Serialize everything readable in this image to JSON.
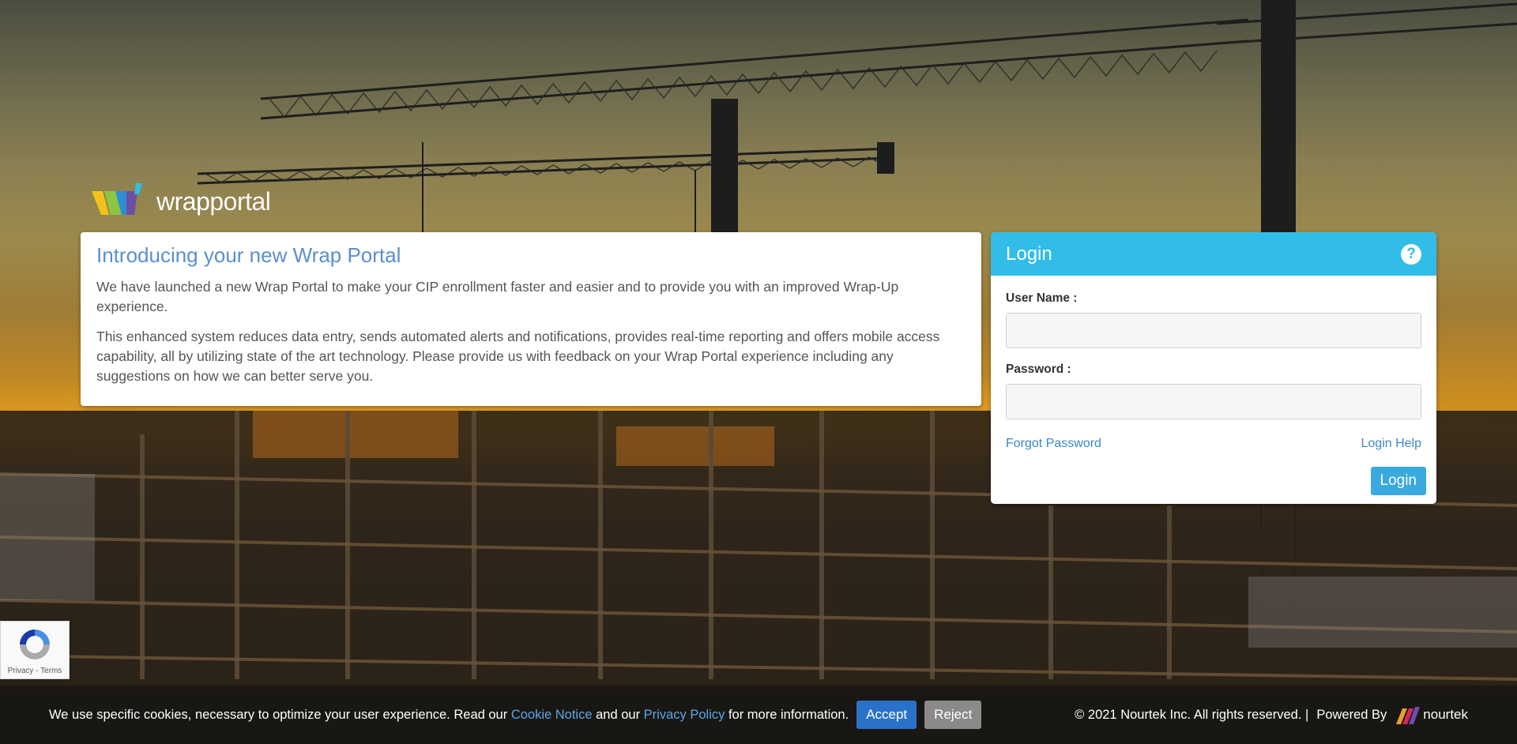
{
  "logo": {
    "text_bold": "wrap",
    "text_light": "portal"
  },
  "intro": {
    "title": "Introducing your new Wrap Portal",
    "paragraph1": "We have launched a new Wrap Portal to make your CIP enrollment faster and easier and to provide you with an improved Wrap-Up experience.",
    "paragraph2": "This enhanced system reduces data entry, sends automated alerts and notifications, provides real-time reporting and offers mobile access capability, all by utilizing state of the art technology. Please provide us with feedback on your Wrap Portal experience including any suggestions on how we can better serve you."
  },
  "login": {
    "title": "Login",
    "help_icon": "?",
    "username_label": "User Name :",
    "username_value": "",
    "password_label": "Password :",
    "password_value": "",
    "forgot_password": "Forgot Password",
    "login_help": "Login Help",
    "submit_label": "Login"
  },
  "recaptcha": {
    "links": "Privacy - Terms"
  },
  "cookie_bar": {
    "text_before": "We use specific cookies, necessary to optimize your user experience. Read our ",
    "cookie_notice": "Cookie Notice",
    "text_mid": " and our ",
    "privacy_policy": "Privacy Policy",
    "text_after": " for more information.",
    "accept": "Accept",
    "reject": "Reject"
  },
  "footer": {
    "copyright": "© 2021 Nourtek Inc. All rights reserved. |",
    "powered_by": "Powered By",
    "brand": "nourtek"
  },
  "colors": {
    "accent_blue": "#31bde8",
    "title_blue": "#5a8fd0",
    "link_blue": "#3a87c8",
    "accept_blue": "#2a72c8",
    "reject_gray": "#8a8a8a"
  }
}
